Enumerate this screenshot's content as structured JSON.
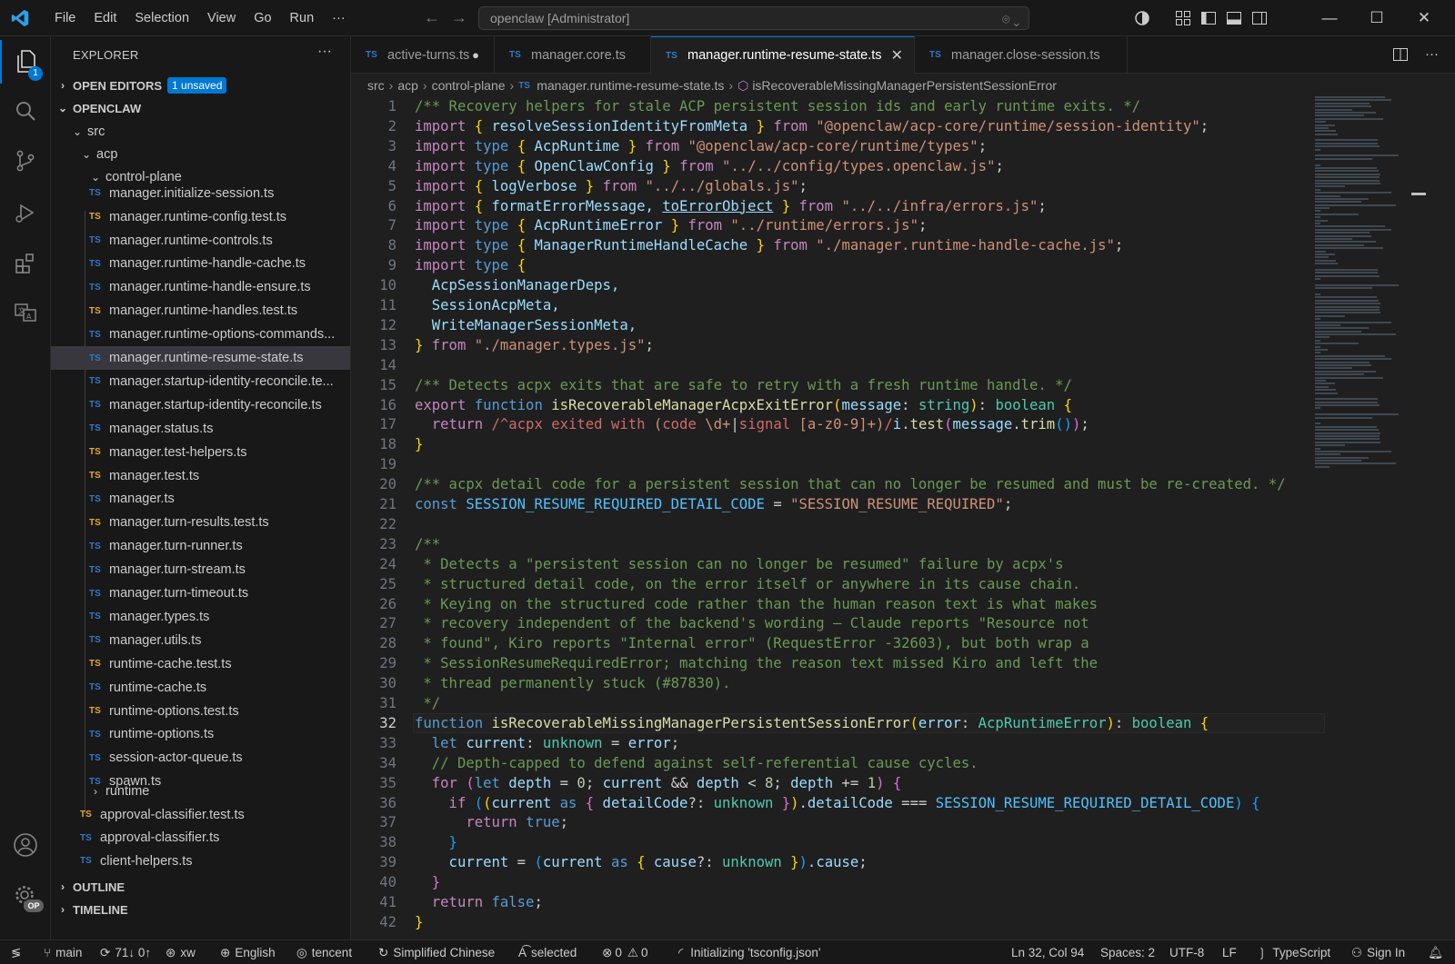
{
  "menu": [
    "File",
    "Edit",
    "Selection",
    "View",
    "Go",
    "Run",
    "···"
  ],
  "command_center": "openclaw [Administrator]",
  "window_controls": [
    "—",
    "☐",
    "✕"
  ],
  "activity": {
    "explorer_badge": "1",
    "settings_badge": "OP"
  },
  "sidebar": {
    "title": "EXPLORER",
    "more": "···",
    "open_editors": "OPEN EDITORS",
    "unsaved_badge": "1 unsaved",
    "root": "OPENCLAW",
    "folders": {
      "src": "src",
      "acp": "acp",
      "control_plane": "control-plane",
      "runtime": "runtime"
    },
    "files": [
      "manager.initialize-session.ts",
      "manager.runtime-config.test.ts",
      "manager.runtime-controls.ts",
      "manager.runtime-handle-cache.ts",
      "manager.runtime-handle-ensure.ts",
      "manager.runtime-handles.test.ts",
      "manager.runtime-options-commands...",
      "manager.runtime-resume-state.ts",
      "manager.startup-identity-reconcile.te...",
      "manager.startup-identity-reconcile.ts",
      "manager.status.ts",
      "manager.test-helpers.ts",
      "manager.test.ts",
      "manager.ts",
      "manager.turn-results.test.ts",
      "manager.turn-runner.ts",
      "manager.turn-stream.ts",
      "manager.turn-timeout.ts",
      "manager.types.ts",
      "manager.utils.ts",
      "runtime-cache.test.ts",
      "runtime-cache.ts",
      "runtime-options.test.ts",
      "runtime-options.ts",
      "session-actor-queue.ts",
      "spawn.ts"
    ],
    "acp_files": [
      "approval-classifier.test.ts",
      "approval-classifier.ts",
      "client-helpers.ts"
    ],
    "outline": "OUTLINE",
    "timeline": "TIMELINE",
    "ts_label": "TS"
  },
  "tabs": [
    {
      "label": "active-turns.ts",
      "dirty": "●"
    },
    {
      "label": "manager.core.ts"
    },
    {
      "label": "manager.runtime-resume-state.ts",
      "close": "✕"
    },
    {
      "label": "manager.close-session.ts"
    }
  ],
  "breadcrumbs": [
    "src",
    "acp",
    "control-plane",
    "manager.runtime-resume-state.ts",
    "isRecoverableMissingManagerPersistentSessionError"
  ],
  "editor": {
    "current_line": 32,
    "lines": [
      [
        [
          "c",
          "/** Recovery helpers for stale ACP persistent session ids and early runtime exits. */"
        ]
      ],
      [
        [
          "ck",
          "import"
        ],
        [
          "p",
          " "
        ],
        [
          "y",
          "{"
        ],
        [
          "v",
          " resolveSessionIdentityFromMeta "
        ],
        [
          "y",
          "}"
        ],
        [
          "ck",
          " from "
        ],
        [
          "s",
          "\"@openclaw/acp-core/runtime/session-identity\""
        ],
        [
          "p",
          ";"
        ]
      ],
      [
        [
          "ck",
          "import"
        ],
        [
          "k",
          " type "
        ],
        [
          "y",
          "{"
        ],
        [
          "v",
          " AcpRuntime "
        ],
        [
          "y",
          "}"
        ],
        [
          "ck",
          " from "
        ],
        [
          "s",
          "\"@openclaw/acp-core/runtime/types\""
        ],
        [
          "p",
          ";"
        ]
      ],
      [
        [
          "ck",
          "import"
        ],
        [
          "k",
          " type "
        ],
        [
          "y",
          "{"
        ],
        [
          "v",
          " OpenClawConfig "
        ],
        [
          "y",
          "}"
        ],
        [
          "ck",
          " from "
        ],
        [
          "s",
          "\"../../config/types.openclaw.js\""
        ],
        [
          "p",
          ";"
        ]
      ],
      [
        [
          "ck",
          "import"
        ],
        [
          "p",
          " "
        ],
        [
          "y",
          "{"
        ],
        [
          "v",
          " logVerbose "
        ],
        [
          "y",
          "}"
        ],
        [
          "ck",
          " from "
        ],
        [
          "s",
          "\"../../globals.js\""
        ],
        [
          "p",
          ";"
        ]
      ],
      [
        [
          "ck",
          "import"
        ],
        [
          "p",
          " "
        ],
        [
          "y",
          "{"
        ],
        [
          "v",
          " formatErrorMessage, "
        ],
        [
          "vu",
          "toErrorObject"
        ],
        [
          "v",
          " "
        ],
        [
          "y",
          "}"
        ],
        [
          "ck",
          " from "
        ],
        [
          "s",
          "\"../../infra/errors.js\""
        ],
        [
          "p",
          ";"
        ]
      ],
      [
        [
          "ck",
          "import"
        ],
        [
          "k",
          " type "
        ],
        [
          "y",
          "{"
        ],
        [
          "v",
          " AcpRuntimeError "
        ],
        [
          "y",
          "}"
        ],
        [
          "ck",
          " from "
        ],
        [
          "s",
          "\"../runtime/errors.js\""
        ],
        [
          "p",
          ";"
        ]
      ],
      [
        [
          "ck",
          "import"
        ],
        [
          "k",
          " type "
        ],
        [
          "y",
          "{"
        ],
        [
          "v",
          " ManagerRuntimeHandleCache "
        ],
        [
          "y",
          "}"
        ],
        [
          "ck",
          " from "
        ],
        [
          "s",
          "\"./manager.runtime-handle-cache.js\""
        ],
        [
          "p",
          ";"
        ]
      ],
      [
        [
          "ck",
          "import"
        ],
        [
          "k",
          " type "
        ],
        [
          "y",
          "{"
        ]
      ],
      [
        [
          "v",
          "  AcpSessionManagerDeps,"
        ]
      ],
      [
        [
          "v",
          "  SessionAcpMeta,"
        ]
      ],
      [
        [
          "v",
          "  WriteManagerSessionMeta,"
        ]
      ],
      [
        [
          "y",
          "}"
        ],
        [
          "ck",
          " from "
        ],
        [
          "s",
          "\"./manager.types.js\""
        ],
        [
          "p",
          ";"
        ]
      ],
      [],
      [
        [
          "c",
          "/** Detects acpx exits that are safe to retry with a fresh runtime handle. */"
        ]
      ],
      [
        [
          "ck",
          "export"
        ],
        [
          "k",
          " function "
        ],
        [
          "f",
          "isRecoverableManagerAcpxExitError"
        ],
        [
          "y",
          "("
        ],
        [
          "v",
          "message"
        ],
        [
          "p",
          ": "
        ],
        [
          "t",
          "string"
        ],
        [
          "y",
          ")"
        ],
        [
          "p",
          ": "
        ],
        [
          "t",
          "boolean"
        ],
        [
          "p",
          " "
        ],
        [
          "y",
          "{"
        ]
      ],
      [
        [
          "ck",
          "  return "
        ],
        [
          "r",
          "/^acpx exited with "
        ],
        [
          "s",
          "("
        ],
        [
          "r",
          "code "
        ],
        [
          "s",
          "\\d+"
        ],
        [
          "p",
          "|"
        ],
        [
          "r",
          "signal "
        ],
        [
          "s",
          "[a-z0-9]+"
        ],
        [
          "s",
          ")"
        ],
        [
          "r",
          "/"
        ],
        [
          "v",
          "i"
        ],
        [
          "p",
          "."
        ],
        [
          "f",
          "test"
        ],
        [
          "mg",
          "("
        ],
        [
          "v",
          "message"
        ],
        [
          "p",
          "."
        ],
        [
          "f",
          "trim"
        ],
        [
          "bl",
          "()"
        ],
        [
          "mg",
          ")"
        ],
        [
          "p",
          ";"
        ]
      ],
      [
        [
          "y",
          "}"
        ]
      ],
      [],
      [
        [
          "c",
          "/** acpx detail code for a persistent session that can no longer be resumed and must be re-created. */"
        ]
      ],
      [
        [
          "k",
          "const "
        ],
        [
          "cst",
          "SESSION_RESUME_REQUIRED_DETAIL_CODE"
        ],
        [
          "p",
          " = "
        ],
        [
          "s",
          "\"SESSION_RESUME_REQUIRED\""
        ],
        [
          "p",
          ";"
        ]
      ],
      [],
      [
        [
          "c",
          "/**"
        ]
      ],
      [
        [
          "c",
          " * Detects a \"persistent session can no longer be resumed\" failure by acpx's"
        ]
      ],
      [
        [
          "c",
          " * structured detail code, on the error itself or anywhere in its cause chain."
        ]
      ],
      [
        [
          "c",
          " * Keying on the structured code rather than the human reason text is what makes"
        ]
      ],
      [
        [
          "c",
          " * recovery independent of the backend's wording — Claude reports \"Resource not"
        ]
      ],
      [
        [
          "c",
          " * found\", Kiro reports \"Internal error\" (RequestError -32603), but both wrap a"
        ]
      ],
      [
        [
          "c",
          " * SessionResumeRequiredError; matching the reason text missed Kiro and left the"
        ]
      ],
      [
        [
          "c",
          " * thread permanently stuck (#87830)."
        ]
      ],
      [
        [
          "c",
          " */"
        ]
      ],
      [
        [
          "k",
          "function "
        ],
        [
          "f",
          "isRecoverableMissingManagerPersistentSessionError"
        ],
        [
          "y",
          "("
        ],
        [
          "v",
          "error"
        ],
        [
          "p",
          ": "
        ],
        [
          "t",
          "AcpRuntimeError"
        ],
        [
          "y",
          ")"
        ],
        [
          "p",
          ": "
        ],
        [
          "t",
          "boolean"
        ],
        [
          "p",
          " "
        ],
        [
          "y",
          "{"
        ]
      ],
      [
        [
          "k",
          "  let "
        ],
        [
          "v",
          "current"
        ],
        [
          "p",
          ": "
        ],
        [
          "t",
          "unknown"
        ],
        [
          "p",
          " = "
        ],
        [
          "v",
          "error"
        ],
        [
          "p",
          ";"
        ]
      ],
      [
        [
          "c",
          "  // Depth-capped to defend against self-referential cause cycles."
        ]
      ],
      [
        [
          "ck",
          "  for "
        ],
        [
          "mg",
          "("
        ],
        [
          "k",
          "let "
        ],
        [
          "v",
          "depth"
        ],
        [
          "p",
          " = "
        ],
        [
          "n",
          "0"
        ],
        [
          "p",
          "; "
        ],
        [
          "v",
          "current"
        ],
        [
          "p",
          " && "
        ],
        [
          "v",
          "depth"
        ],
        [
          "p",
          " < "
        ],
        [
          "n",
          "8"
        ],
        [
          "p",
          "; "
        ],
        [
          "v",
          "depth"
        ],
        [
          "p",
          " += "
        ],
        [
          "n",
          "1"
        ],
        [
          "mg",
          ")"
        ],
        [
          "p",
          " "
        ],
        [
          "mg",
          "{"
        ]
      ],
      [
        [
          "ck",
          "    if "
        ],
        [
          "bl",
          "("
        ],
        [
          "y",
          "("
        ],
        [
          "v",
          "current"
        ],
        [
          "k",
          " as "
        ],
        [
          "mg",
          "{"
        ],
        [
          "v",
          " detailCode"
        ],
        [
          "p",
          "?: "
        ],
        [
          "t",
          "unknown"
        ],
        [
          "mg",
          " }"
        ],
        [
          "y",
          ")"
        ],
        [
          "p",
          "."
        ],
        [
          "v",
          "detailCode"
        ],
        [
          "p",
          " === "
        ],
        [
          "cst",
          "SESSION_RESUME_REQUIRED_DETAIL_CODE"
        ],
        [
          "bl",
          ")"
        ],
        [
          "p",
          " "
        ],
        [
          "bl",
          "{"
        ]
      ],
      [
        [
          "ck",
          "      return "
        ],
        [
          "k",
          "true"
        ],
        [
          "p",
          ";"
        ]
      ],
      [
        [
          "bl",
          "    }"
        ]
      ],
      [
        [
          "v",
          "    current"
        ],
        [
          "p",
          " = "
        ],
        [
          "bl",
          "("
        ],
        [
          "v",
          "current"
        ],
        [
          "k",
          " as "
        ],
        [
          "y",
          "{"
        ],
        [
          "v",
          " cause"
        ],
        [
          "p",
          "?: "
        ],
        [
          "t",
          "unknown"
        ],
        [
          "y",
          " }"
        ],
        [
          "bl",
          ")"
        ],
        [
          "p",
          "."
        ],
        [
          "v",
          "cause"
        ],
        [
          "p",
          ";"
        ]
      ],
      [
        [
          "mg",
          "  }"
        ]
      ],
      [
        [
          "ck",
          "  return "
        ],
        [
          "k",
          "false"
        ],
        [
          "p",
          ";"
        ]
      ],
      [
        [
          "y",
          "}"
        ]
      ]
    ]
  },
  "status": {
    "branch": "main",
    "sync": "71↓ 0↑",
    "user": "xw",
    "lang1": "English",
    "account": "tencent",
    "lang2": "Simplified Chinese",
    "selected": "selected",
    "errors": "0",
    "warnings": "0",
    "init": "Initializing 'tsconfig.json'",
    "position": "Ln 32, Col 94",
    "spaces": "Spaces: 2",
    "encoding": "UTF-8",
    "eol": "LF",
    "language": "TypeScript",
    "signin": "Sign In"
  },
  "colors": {
    "accent": "#0078d4",
    "ts_blue": "#3178c6",
    "ts_test": "#e8a736"
  }
}
